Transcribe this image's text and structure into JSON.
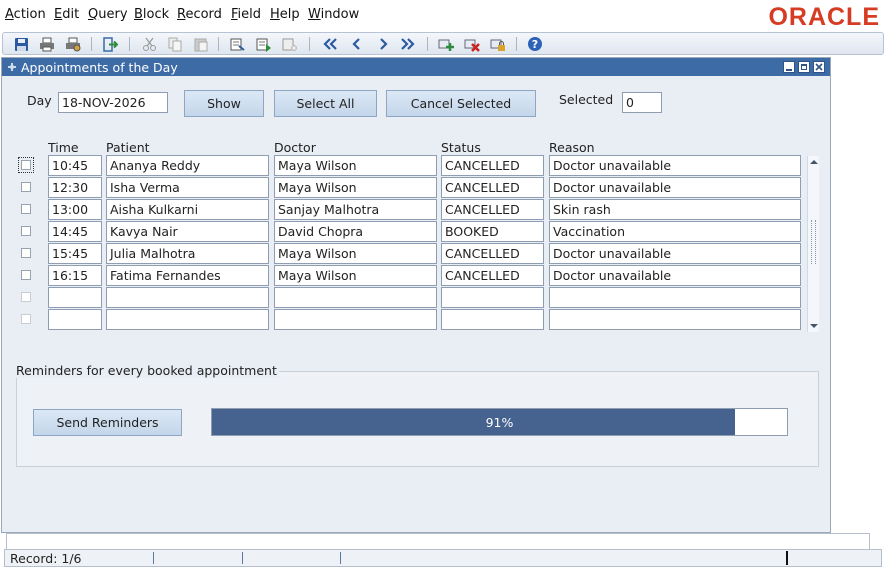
{
  "menu": {
    "items": [
      {
        "label": "Action",
        "u": "A",
        "rest": "ction"
      },
      {
        "label": "Edit",
        "u": "E",
        "rest": "dit"
      },
      {
        "label": "Query",
        "u": "Q",
        "rest": "uery"
      },
      {
        "label": "Block",
        "u": "B",
        "rest": "lock"
      },
      {
        "label": "Record",
        "u": "R",
        "rest": "ecord"
      },
      {
        "label": "Field",
        "u": "F",
        "rest": "ield"
      },
      {
        "label": "Help",
        "u": "H",
        "rest": "elp"
      },
      {
        "label": "Window",
        "u": "W",
        "rest": "indow"
      }
    ],
    "logo": "ORACLE"
  },
  "toolbar": {
    "icons": [
      "save-icon",
      "print-icon",
      "print-setup-icon",
      "exit-icon",
      "cut-icon",
      "copy-icon",
      "paste-icon",
      "enter-query-icon",
      "execute-query-icon",
      "cancel-query-icon",
      "first-record-icon",
      "previous-record-icon",
      "next-record-icon",
      "last-record-icon",
      "insert-record-icon",
      "delete-record-icon",
      "lock-record-icon",
      "help-icon"
    ]
  },
  "window": {
    "title": "Appointments of the Day"
  },
  "form": {
    "day_label": "Day",
    "day_value": "18-NOV-2026",
    "show_button": "Show",
    "select_all_button": "Select All",
    "cancel_selected_button": "Cancel Selected",
    "selected_label": "Selected",
    "selected_value": "0"
  },
  "table": {
    "headers": {
      "time": "Time",
      "patient": "Patient",
      "doctor": "Doctor",
      "status": "Status",
      "reason": "Reason"
    },
    "rows": [
      {
        "time": "10:45",
        "patient": "Ananya Reddy",
        "doctor": "Maya Wilson",
        "status": "CANCELLED",
        "reason": "Doctor unavailable"
      },
      {
        "time": "12:30",
        "patient": "Isha Verma",
        "doctor": "Maya Wilson",
        "status": "CANCELLED",
        "reason": "Doctor unavailable"
      },
      {
        "time": "13:00",
        "patient": "Aisha Kulkarni",
        "doctor": "Sanjay Malhotra",
        "status": "CANCELLED",
        "reason": "Skin rash"
      },
      {
        "time": "14:45",
        "patient": "Kavya Nair",
        "doctor": "David Chopra",
        "status": "BOOKED",
        "reason": "Vaccination"
      },
      {
        "time": "15:45",
        "patient": "Julia Malhotra",
        "doctor": "Maya Wilson",
        "status": "CANCELLED",
        "reason": "Doctor unavailable"
      },
      {
        "time": "16:15",
        "patient": "Fatima Fernandes",
        "doctor": "Maya Wilson",
        "status": "CANCELLED",
        "reason": "Doctor unavailable"
      },
      {
        "time": "",
        "patient": "",
        "doctor": "",
        "status": "",
        "reason": ""
      },
      {
        "time": "",
        "patient": "",
        "doctor": "",
        "status": "",
        "reason": ""
      }
    ]
  },
  "reminders": {
    "group_title": "Reminders for every booked appointment",
    "send_button": "Send Reminders",
    "progress_percent": 91,
    "progress_text": "91%"
  },
  "status": {
    "record": "Record: 1/6"
  },
  "colors": {
    "title_bar": "#3d6ba6",
    "progress_fill": "#45638e",
    "logo": "#d63b23"
  }
}
